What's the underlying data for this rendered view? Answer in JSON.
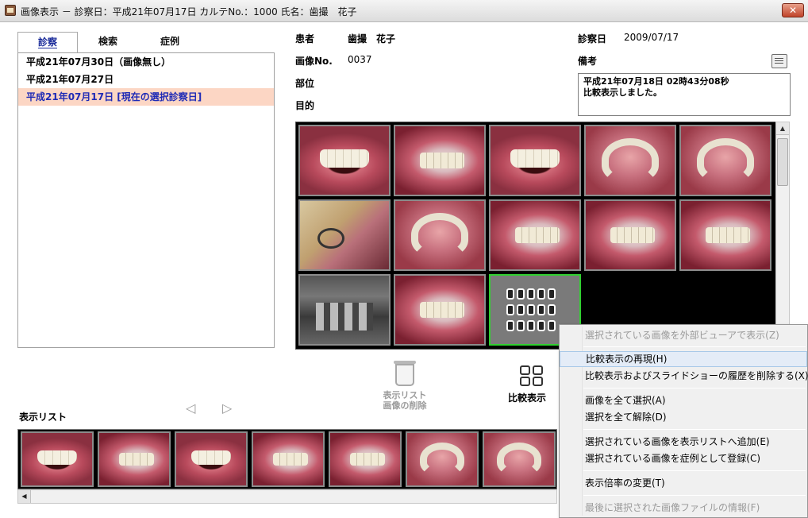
{
  "window": {
    "title": "画像表示 － 診察日：平成21年07月17日 カルテNo.：1000 氏名：歯撮　花子",
    "close": "✕"
  },
  "tabs": [
    "診察",
    "検索",
    "症例"
  ],
  "exam_dates": [
    "平成21年07月30日（画像無し）",
    "平成21年07月27日",
    "平成21年07月17日 [現在の選択診察日]"
  ],
  "info": {
    "patient_label": "患者",
    "patient_name": "歯撮　花子",
    "image_no_label": "画像No.",
    "image_no": "0037",
    "part_label": "部位",
    "purpose_label": "目的",
    "exam_date_label": "診察日",
    "exam_date": "2009/07/17",
    "memo_label": "備考",
    "memo_line1": "平成21年07月18日 02時43分08秒",
    "memo_line2": "比較表示しました。"
  },
  "controls": {
    "trash_label_1": "表示リスト",
    "trash_label_2": "画像の削除",
    "compare_label": "比較表示",
    "display_list_label": "表示リスト"
  },
  "context_menu": {
    "items": [
      "選択されている画像を外部ビューアで表示(Z)",
      "比較表示の再現(H)",
      "比較表示およびスライドショーの履歴を削除する(X)",
      "画像を全て選択(A)",
      "選択を全て解除(D)",
      "選択されている画像を表示リストへ追加(E)",
      "選択されている画像を症例として登録(C)",
      "表示倍率の変更(T)",
      "最後に選択された画像ファイルの情報(F)"
    ]
  }
}
